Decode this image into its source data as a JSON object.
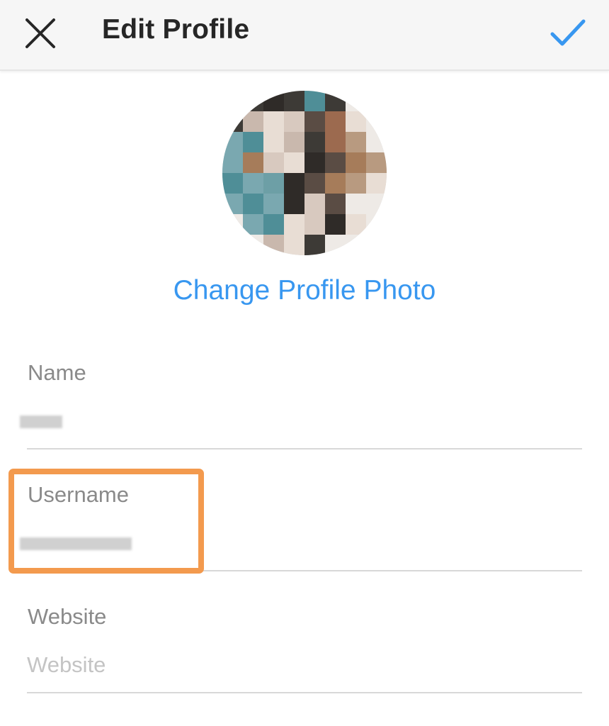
{
  "header": {
    "title": "Edit Profile",
    "close_icon": "close-icon",
    "done_icon": "checkmark-icon",
    "accent_color": "#3897f0"
  },
  "profile": {
    "change_photo_label": "Change Profile Photo"
  },
  "form": {
    "name": {
      "label": "Name"
    },
    "username": {
      "label": "Username"
    },
    "website": {
      "label": "Website",
      "placeholder": "Website"
    }
  },
  "annotation": {
    "highlight_color": "#f39a4e"
  }
}
